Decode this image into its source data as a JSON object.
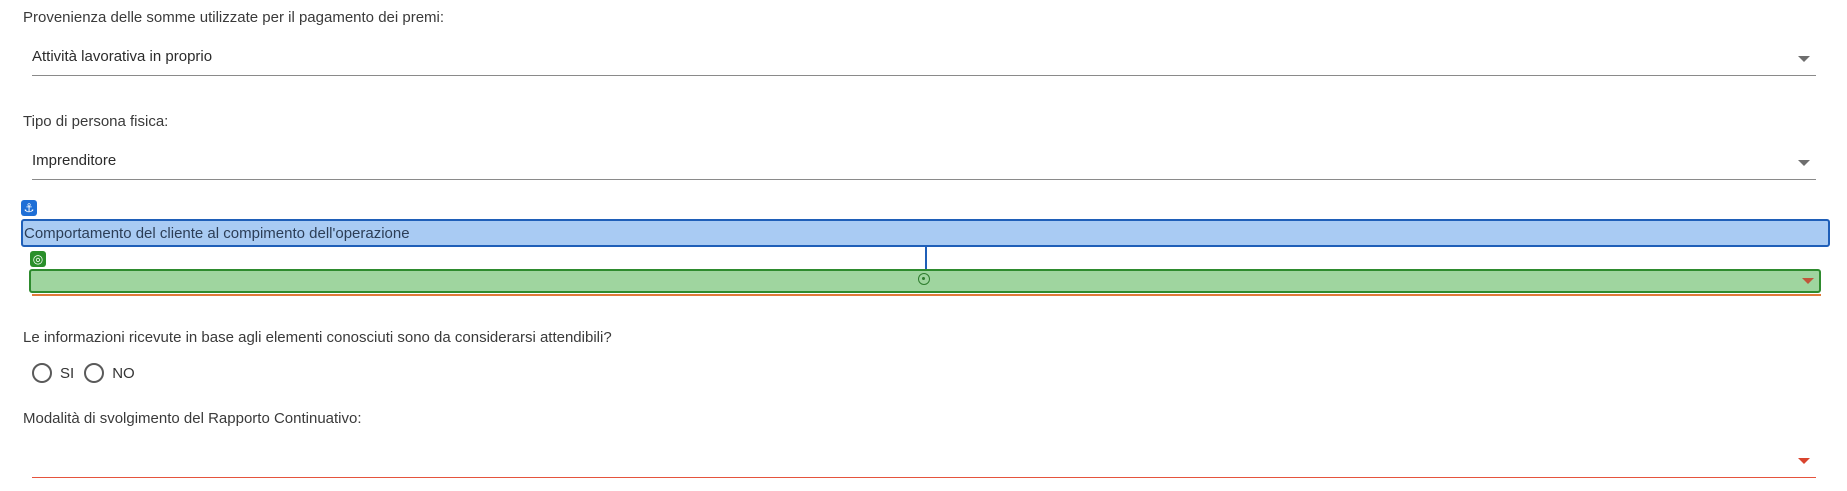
{
  "fields": {
    "provenienza": {
      "label": "Provenienza delle somme utilizzate per il pagamento dei premi:",
      "value": "Attività lavorativa in proprio"
    },
    "tipo_persona": {
      "label": "Tipo di persona fisica:",
      "value": "Imprenditore"
    },
    "comportamento": {
      "label": "Comportamento del cliente al compimento dell'operazione",
      "value": ""
    },
    "informazioni": {
      "label": "Le informazioni ricevute in base agli elementi conosciuti sono da considerarsi attendibili?",
      "options": [
        "SI",
        "NO"
      ],
      "selected": null
    },
    "modalita": {
      "label": "Modalità di svolgimento del Rapporto Continuativo:",
      "value": ""
    }
  },
  "icons": {
    "dropdown": "chevron-down-icon",
    "anchor": "anchor-icon",
    "target": "target-icon",
    "crosshair": "crosshair-icon"
  },
  "colors": {
    "highlight_blue": "#a9cbf3",
    "highlight_blue_border": "#1f5fb8",
    "highlight_green": "#9fd59f",
    "highlight_green_border": "#2e8b2e",
    "error_underline": "#e5533d"
  }
}
